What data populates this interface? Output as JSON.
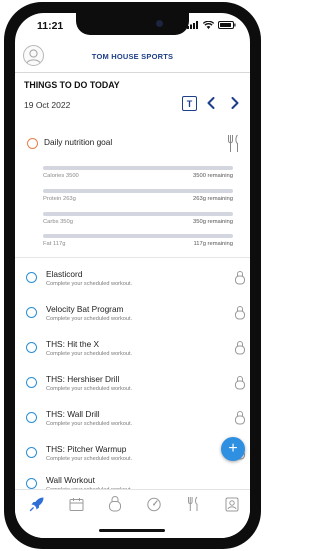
{
  "status_bar": {
    "time": "11:21"
  },
  "header": {
    "brand": "TOM HOUSE SPORTS"
  },
  "section": {
    "title": "THINGS TO DO TODAY",
    "date": "19 Oct 2022",
    "today_button": "T"
  },
  "nutrition": {
    "title": "Daily nutrition goal",
    "macros": [
      {
        "label": "Calories 3500",
        "remaining": "3500 remaining",
        "progress_fraction": 0.0
      },
      {
        "label": "Protein 263g",
        "remaining": "263g remaining",
        "progress_fraction": 0.0
      },
      {
        "label": "Carbs 350g",
        "remaining": "350g remaining",
        "progress_fraction": 0.0
      },
      {
        "label": "Fat 117g",
        "remaining": "117g remaining",
        "progress_fraction": 0.0
      }
    ]
  },
  "workouts": [
    {
      "name": "Elasticord",
      "subtitle": "Complete your scheduled workout."
    },
    {
      "name": "Velocity Bat Program",
      "subtitle": "Complete your scheduled workout."
    },
    {
      "name": "THS: Hit the X",
      "subtitle": "Complete your scheduled workout."
    },
    {
      "name": "THS: Hershiser Drill",
      "subtitle": "Complete your scheduled workout."
    },
    {
      "name": "THS: Wall Drill",
      "subtitle": "Complete your scheduled workout."
    },
    {
      "name": "THS: Pitcher Warmup",
      "subtitle": "Complete your scheduled workout."
    },
    {
      "name": "Wall Workout",
      "subtitle": "Complete your scheduled workout."
    }
  ],
  "fab": {
    "label": "+"
  },
  "tabs": [
    {
      "icon": "rocket-icon",
      "active": true
    },
    {
      "icon": "calendar-icon",
      "active": false
    },
    {
      "icon": "kettlebell-icon",
      "active": false
    },
    {
      "icon": "dashboard-icon",
      "active": false
    },
    {
      "icon": "cutlery-icon",
      "active": false
    },
    {
      "icon": "profile-icon",
      "active": false
    }
  ],
  "colors": {
    "brand_navy": "#1e3f8a",
    "task_ring_blue": "#2a8fd6",
    "nutrition_ring_orange": "#e8804c",
    "fab_blue": "#2f8fe0",
    "active_tab_blue": "#2f6fd6"
  }
}
